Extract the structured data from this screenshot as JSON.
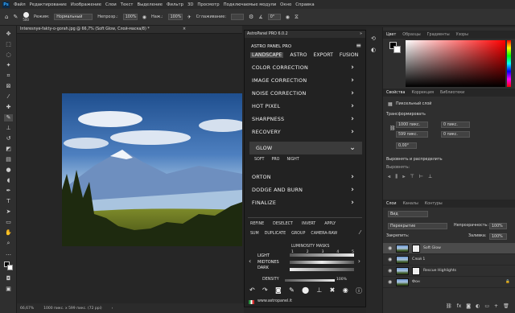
{
  "menu": {
    "app_logo": "Ps",
    "items": [
      "Файл",
      "Редактирование",
      "Изображение",
      "Слои",
      "Текст",
      "Выделение",
      "Фильтр",
      "3D",
      "Просмотр",
      "Подключаемые модули",
      "Окно",
      "Справка"
    ]
  },
  "options": {
    "size": "500",
    "mode_label": "Режим:",
    "mode_value": "Нормальный",
    "opacity_label": "Непрозр.:",
    "opacity_value": "100%",
    "flow_label": "Наж.:",
    "flow_value": "100%",
    "smooth_label": "Сглаживание:",
    "angle": "0°"
  },
  "document": {
    "tab_title": "Interesnye-fakty-o-gorah.jpg @ 66,7% (Soft Glow, Слой-маска/8) *",
    "zoom": "66,67%",
    "size_info": "1000 пикс. x 599 пикс. (72 ppi)"
  },
  "astro": {
    "title": "AstroPanel PRO 6.0.2",
    "brand": "ASTRO PANEL PRO",
    "tabs": [
      "LANDSCAPE",
      "ASTRO",
      "EXPORT",
      "FUSION"
    ],
    "menu": [
      "COLOR CORRECTION",
      "IMAGE CORRECTION",
      "NOISE CORRECTION",
      "HOT PIXEL",
      "SHARPNESS",
      "RECOVERY"
    ],
    "glow": "GLOW",
    "glow_sub": [
      "SOFT",
      "PRO",
      "NIGHT"
    ],
    "menu2": [
      "ORTON",
      "DODGE AND BURN",
      "FINALIZE"
    ],
    "actions1": [
      "REFINE",
      "DESELECT",
      "INVERT",
      "APPLY"
    ],
    "actions2": [
      "SUM",
      "DUPLICATE",
      "GROUP",
      "CAMERA-RAW"
    ],
    "masks_title": "LUMINOSITY MASKS",
    "mask_rows": [
      "LIGHT",
      "MIDTONES",
      "DARK"
    ],
    "mask_nums": [
      "1",
      "2",
      "3",
      "4",
      "5"
    ],
    "density_label": "DENSITY",
    "density_value": "100%",
    "website": "www.astropanel.it"
  },
  "right": {
    "color_tabs": [
      "Цвет",
      "Образцы",
      "Градиенты",
      "Узоры"
    ],
    "props_tabs": [
      "Свойства",
      "Коррекция",
      "Библиотеки"
    ],
    "pixel_layer": "Пиксельный слой",
    "transform": "Трансформировать",
    "w": "1000 пикс.",
    "h": "599 пикс.",
    "x": "0 пикс.",
    "y": "0 пикс.",
    "angle": "0,00°",
    "align_title": "Выровнять и распределить",
    "align_label": "Выровнять:",
    "layers_tabs": [
      "Слои",
      "Каналы",
      "Контуры"
    ],
    "search": "Вид",
    "blend": "Перекрытие",
    "opacity_label": "Непрозрачность:",
    "opacity_value": "100%",
    "lock_label": "Закрепить:",
    "fill_label": "Заливка:",
    "fill_value": "100%",
    "layers": [
      "Soft Glow",
      "Слой 1",
      "Rescue Highlights",
      "Фон"
    ]
  },
  "colors": {
    "bg": "#262626",
    "panel": "#2f2f2f",
    "astro_bg": "#222222",
    "accent": "#31a8ff"
  }
}
